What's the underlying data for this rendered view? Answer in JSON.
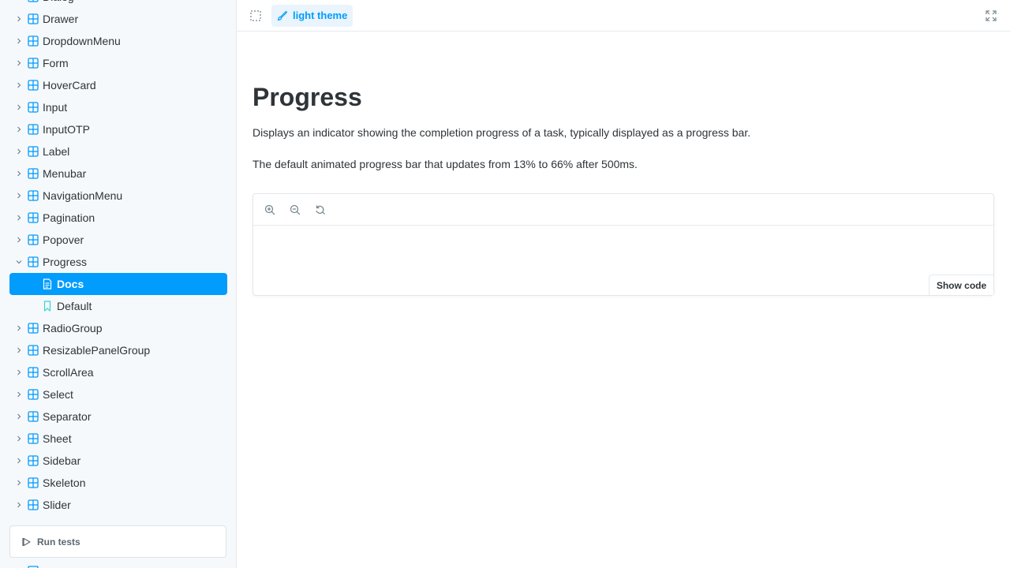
{
  "colors": {
    "accent": "#029cfd",
    "selected_bg": "#029cfd",
    "sidebar_bg": "#f6f9fc",
    "text": "#2e3438"
  },
  "sidebar": {
    "items": [
      {
        "label": "Dialog",
        "icon": "component-icon",
        "expanded": false
      },
      {
        "label": "Drawer",
        "icon": "component-icon",
        "expanded": false
      },
      {
        "label": "DropdownMenu",
        "icon": "component-icon",
        "expanded": false
      },
      {
        "label": "Form",
        "icon": "component-icon",
        "expanded": false
      },
      {
        "label": "HoverCard",
        "icon": "component-icon",
        "expanded": false
      },
      {
        "label": "Input",
        "icon": "component-icon",
        "expanded": false
      },
      {
        "label": "InputOTP",
        "icon": "component-icon",
        "expanded": false
      },
      {
        "label": "Label",
        "icon": "component-icon",
        "expanded": false
      },
      {
        "label": "Menubar",
        "icon": "component-icon",
        "expanded": false
      },
      {
        "label": "NavigationMenu",
        "icon": "component-icon",
        "expanded": false
      },
      {
        "label": "Pagination",
        "icon": "component-icon",
        "expanded": false
      },
      {
        "label": "Popover",
        "icon": "component-icon",
        "expanded": false
      },
      {
        "label": "Progress",
        "icon": "component-icon",
        "expanded": true
      },
      {
        "label": "Docs",
        "icon": "document-icon",
        "child": true,
        "selected": true
      },
      {
        "label": "Default",
        "icon": "bookmark-icon",
        "child": true
      },
      {
        "label": "RadioGroup",
        "icon": "component-icon",
        "expanded": false
      },
      {
        "label": "ResizablePanelGroup",
        "icon": "component-icon",
        "expanded": false
      },
      {
        "label": "ScrollArea",
        "icon": "component-icon",
        "expanded": false
      },
      {
        "label": "Select",
        "icon": "component-icon",
        "expanded": false
      },
      {
        "label": "Separator",
        "icon": "component-icon",
        "expanded": false
      },
      {
        "label": "Sheet",
        "icon": "component-icon",
        "expanded": false
      },
      {
        "label": "Sidebar",
        "icon": "component-icon",
        "expanded": false
      },
      {
        "label": "Skeleton",
        "icon": "component-icon",
        "expanded": false
      },
      {
        "label": "Slider",
        "icon": "component-icon",
        "expanded": false
      }
    ],
    "run_tests_label": "Run tests"
  },
  "toolbar": {
    "theme_label": "light theme"
  },
  "page": {
    "title": "Progress",
    "description": "Displays an indicator showing the completion progress of a task, typically displayed as a progress bar.",
    "story_description": "The default animated progress bar that updates from 13% to 66% after 500ms."
  },
  "preview": {
    "show_code_label": "Show code"
  }
}
